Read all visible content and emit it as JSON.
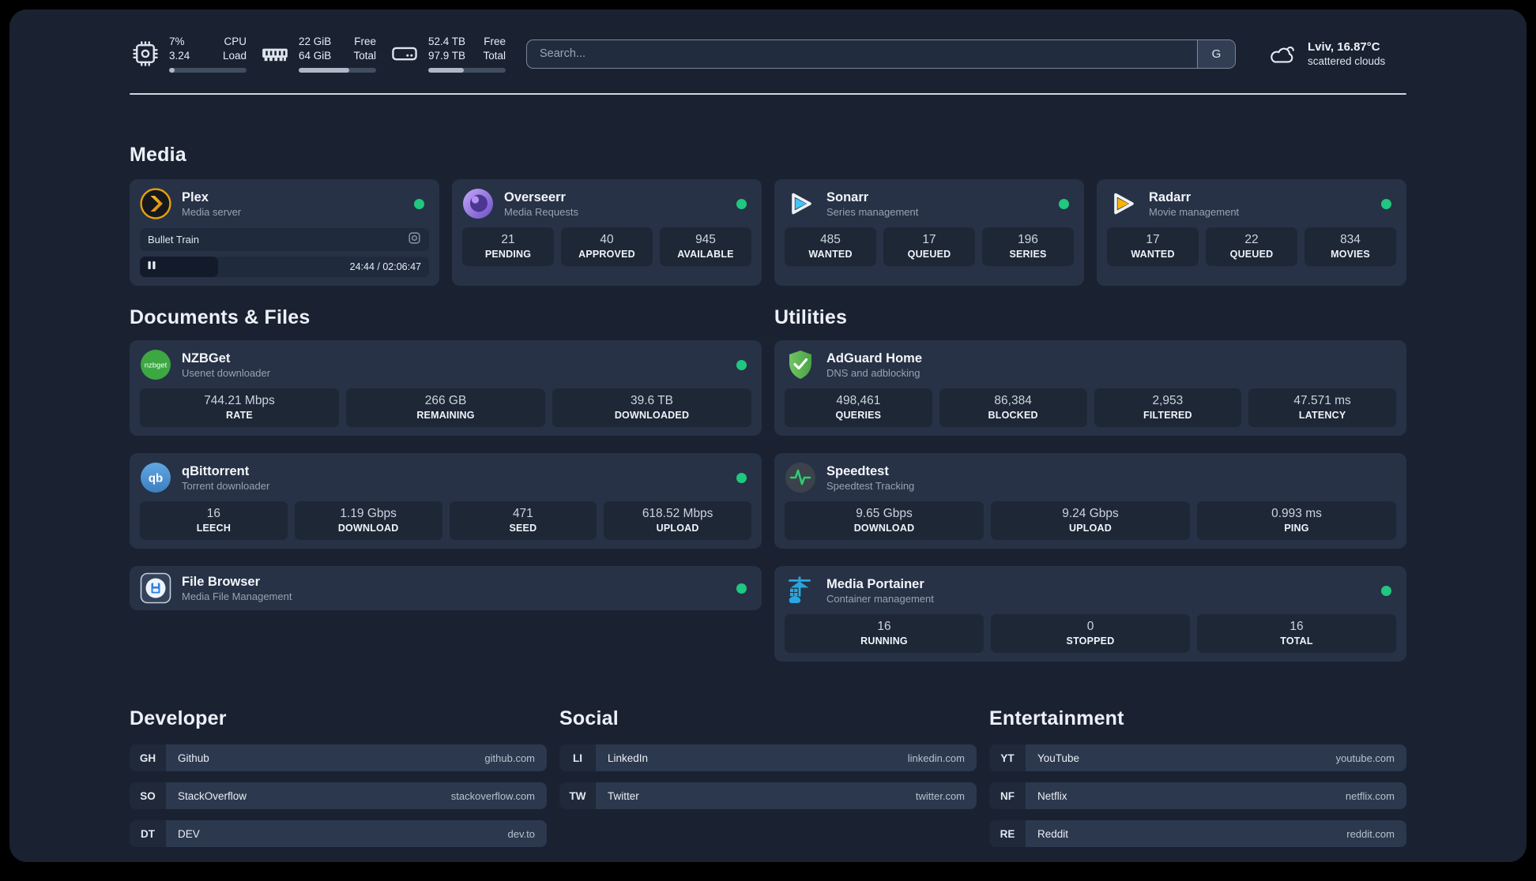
{
  "colors": {
    "status_green": "#1fc77f",
    "plex_orange": "#e5a00d",
    "sonarr_blue": "#3fc4f3",
    "radarr_yellow": "#f7b500",
    "nzbget_green": "#3da742",
    "qbittorrent_blue": "#4a8fd6",
    "adguard_green": "#5cb353",
    "speedtest_green": "#2ecc71",
    "portainer_blue": "#29a8e0",
    "overseerr_purple": "#8a63d2",
    "filebrowser_blue": "#2d7fe0"
  },
  "header": {
    "system_stats": [
      {
        "icon": "cpu-icon",
        "values": [
          "7%",
          "3.24"
        ],
        "labels": [
          "CPU",
          "Load"
        ],
        "progress_pct": 7
      },
      {
        "icon": "ram-icon",
        "values": [
          "22 GiB",
          "64 GiB"
        ],
        "labels": [
          "Free",
          "Total"
        ],
        "progress_pct": 65
      },
      {
        "icon": "disk-icon",
        "values": [
          "52.4 TB",
          "97.9 TB"
        ],
        "labels": [
          "Free",
          "Total"
        ],
        "progress_pct": 46
      }
    ],
    "search": {
      "placeholder": "Search...",
      "engine_button": "G"
    },
    "weather": {
      "icon": "cloud-icon",
      "location": "Lviv, 16.87°C",
      "condition": "scattered clouds"
    }
  },
  "service_sections": [
    {
      "title": "Media",
      "layout": "row-4",
      "services": [
        {
          "icon": "plex-icon",
          "name": "Plex",
          "desc": "Media server",
          "status_dot": true,
          "player": {
            "title": "Bullet Train",
            "control": "pause",
            "time": "24:44 / 02:06:47"
          },
          "stats": []
        },
        {
          "icon": "overseerr-icon",
          "name": "Overseerr",
          "desc": "Media Requests",
          "status_dot": true,
          "stats": [
            {
              "value": "21",
              "label": "PENDING"
            },
            {
              "value": "40",
              "label": "APPROVED"
            },
            {
              "value": "945",
              "label": "AVAILABLE"
            }
          ]
        },
        {
          "icon": "sonarr-icon",
          "name": "Sonarr",
          "desc": "Series management",
          "status_dot": true,
          "stats": [
            {
              "value": "485",
              "label": "WANTED"
            },
            {
              "value": "17",
              "label": "QUEUED"
            },
            {
              "value": "196",
              "label": "SERIES"
            }
          ]
        },
        {
          "icon": "radarr-icon",
          "name": "Radarr",
          "desc": "Movie management",
          "status_dot": true,
          "stats": [
            {
              "value": "17",
              "label": "WANTED"
            },
            {
              "value": "22",
              "label": "QUEUED"
            },
            {
              "value": "834",
              "label": "MOVIES"
            }
          ]
        }
      ]
    },
    {
      "title": "Documents & Files",
      "layout": "column-left",
      "services": [
        {
          "icon": "nzbget-icon",
          "name": "NZBGet",
          "desc": "Usenet downloader",
          "status_dot": true,
          "stats": [
            {
              "value": "744.21 Mbps",
              "label": "RATE"
            },
            {
              "value": "266 GB",
              "label": "REMAINING"
            },
            {
              "value": "39.6 TB",
              "label": "DOWNLOADED"
            }
          ]
        },
        {
          "icon": "qbittorrent-icon",
          "name": "qBittorrent",
          "desc": "Torrent downloader",
          "status_dot": true,
          "stats": [
            {
              "value": "16",
              "label": "LEECH"
            },
            {
              "value": "1.19 Gbps",
              "label": "DOWNLOAD"
            },
            {
              "value": "471",
              "label": "SEED"
            },
            {
              "value": "618.52 Mbps",
              "label": "UPLOAD"
            }
          ]
        },
        {
          "icon": "filebrowser-icon",
          "name": "File Browser",
          "desc": "Media File Management",
          "status_dot": true,
          "stats": []
        }
      ]
    },
    {
      "title": "Utilities",
      "layout": "column-right",
      "services": [
        {
          "icon": "adguard-icon",
          "name": "AdGuard Home",
          "desc": "DNS and adblocking",
          "status_dot": false,
          "stats": [
            {
              "value": "498,461",
              "label": "QUERIES"
            },
            {
              "value": "86,384",
              "label": "BLOCKED"
            },
            {
              "value": "2,953",
              "label": "FILTERED"
            },
            {
              "value": "47.571 ms",
              "label": "LATENCY"
            }
          ]
        },
        {
          "icon": "speedtest-icon",
          "name": "Speedtest",
          "desc": "Speedtest Tracking",
          "status_dot": false,
          "stats": [
            {
              "value": "9.65 Gbps",
              "label": "DOWNLOAD"
            },
            {
              "value": "9.24 Gbps",
              "label": "UPLOAD"
            },
            {
              "value": "0.993 ms",
              "label": "PING"
            }
          ]
        },
        {
          "icon": "portainer-icon",
          "name": "Media Portainer",
          "desc": "Container management",
          "status_dot": true,
          "stats": [
            {
              "value": "16",
              "label": "RUNNING"
            },
            {
              "value": "0",
              "label": "STOPPED"
            },
            {
              "value": "16",
              "label": "TOTAL"
            }
          ]
        }
      ]
    }
  ],
  "bookmark_sections": [
    {
      "title": "Developer",
      "links": [
        {
          "abbr": "GH",
          "name": "Github",
          "domain": "github.com"
        },
        {
          "abbr": "SO",
          "name": "StackOverflow",
          "domain": "stackoverflow.com"
        },
        {
          "abbr": "DT",
          "name": "DEV",
          "domain": "dev.to"
        }
      ]
    },
    {
      "title": "Social",
      "links": [
        {
          "abbr": "LI",
          "name": "LinkedIn",
          "domain": "linkedin.com"
        },
        {
          "abbr": "TW",
          "name": "Twitter",
          "domain": "twitter.com"
        }
      ]
    },
    {
      "title": "Entertainment",
      "links": [
        {
          "abbr": "YT",
          "name": "YouTube",
          "domain": "youtube.com"
        },
        {
          "abbr": "NF",
          "name": "Netflix",
          "domain": "netflix.com"
        },
        {
          "abbr": "RE",
          "name": "Reddit",
          "domain": "reddit.com"
        }
      ]
    }
  ]
}
